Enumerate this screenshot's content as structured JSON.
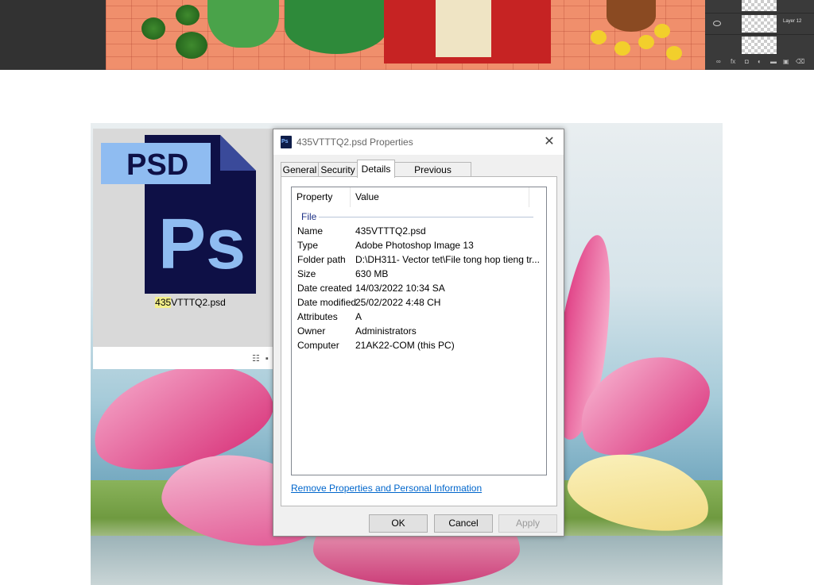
{
  "photoshop": {
    "layers": [
      {
        "label": ""
      },
      {
        "label": "Layer 12"
      },
      {
        "label": ""
      }
    ]
  },
  "explorer": {
    "icon_badge": "PSD",
    "icon_letters": "Ps",
    "file_name_highlight": "435",
    "file_name_rest": "VTTTQ2.psd",
    "view_icons": "☷ ▪"
  },
  "dialog": {
    "title": "435VTTTQ2.psd Properties",
    "title_icon": "Ps",
    "close_glyph": "✕",
    "tabs": [
      {
        "label": "General",
        "active": false
      },
      {
        "label": "Security",
        "active": false
      },
      {
        "label": "Details",
        "active": true
      },
      {
        "label": "Previous Versions",
        "active": false
      }
    ],
    "columns": {
      "property": "Property",
      "value": "Value"
    },
    "group": "File",
    "rows": [
      {
        "name": "Name",
        "value": "435VTTTQ2.psd"
      },
      {
        "name": "Type",
        "value": "Adobe Photoshop Image 13"
      },
      {
        "name": "Folder path",
        "value": "D:\\DH311- Vector tet\\File tong hop tieng tr..."
      },
      {
        "name": "Size",
        "value": "630 MB"
      },
      {
        "name": "Date created",
        "value": "14/03/2022 10:34 SA"
      },
      {
        "name": "Date modified",
        "value": "25/02/2022 4:48 CH"
      },
      {
        "name": "Attributes",
        "value": "A"
      },
      {
        "name": "Owner",
        "value": "Administrators"
      },
      {
        "name": "Computer",
        "value": "21AK22-COM (this PC)"
      }
    ],
    "remove_link": "Remove Properties and Personal Information",
    "buttons": {
      "ok": "OK",
      "cancel": "Cancel",
      "apply": "Apply"
    }
  }
}
